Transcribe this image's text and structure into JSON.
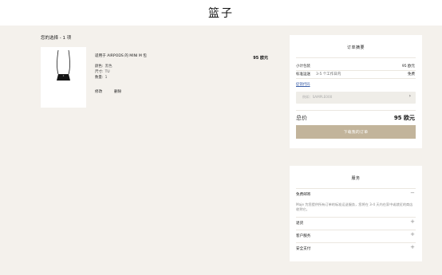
{
  "header": {
    "title": "篮子"
  },
  "selection": {
    "title": "您的选择 - 1 项"
  },
  "item": {
    "name": "适用于 AIRPODS 的 MINI M 包",
    "price": "95 欧元",
    "attributes": [
      {
        "key": "颜色:",
        "value": "黑色"
      },
      {
        "key": "尺寸:",
        "value": "TU"
      },
      {
        "key": "数量:",
        "value": "1"
      }
    ],
    "edit_label": "修改",
    "delete_label": "删除"
  },
  "summary": {
    "title": "订单摘要",
    "subtotal_label": "小计包装",
    "subtotal_value": "95 欧元",
    "shipping_label": "标准运送",
    "shipping_desc": "3-5 个工作日内",
    "shipping_value": "免费",
    "promo_link": "促销代码",
    "promo_placeholder": "例如：SAMPLE000",
    "promo_submit": "›",
    "total_label": "总价",
    "total_value": "95 欧元",
    "checkout_label": "下载我的订单"
  },
  "services": {
    "title": "服务",
    "items": [
      {
        "label": "免费邮寄",
        "sign": "−",
        "expanded": true,
        "description": "Maje 为您提供所有订单的标准运送服务，您将在 3-4 天内在家中或就近的商店收到它。"
      },
      {
        "label": "退货",
        "sign": "+"
      },
      {
        "label": "客户服务",
        "sign": "+"
      },
      {
        "label": "安全支付",
        "sign": "+"
      }
    ]
  },
  "colors": {
    "page_background": "#f4f1ec",
    "button_accent": "#c2b49b",
    "link": "#3b5fa8"
  }
}
